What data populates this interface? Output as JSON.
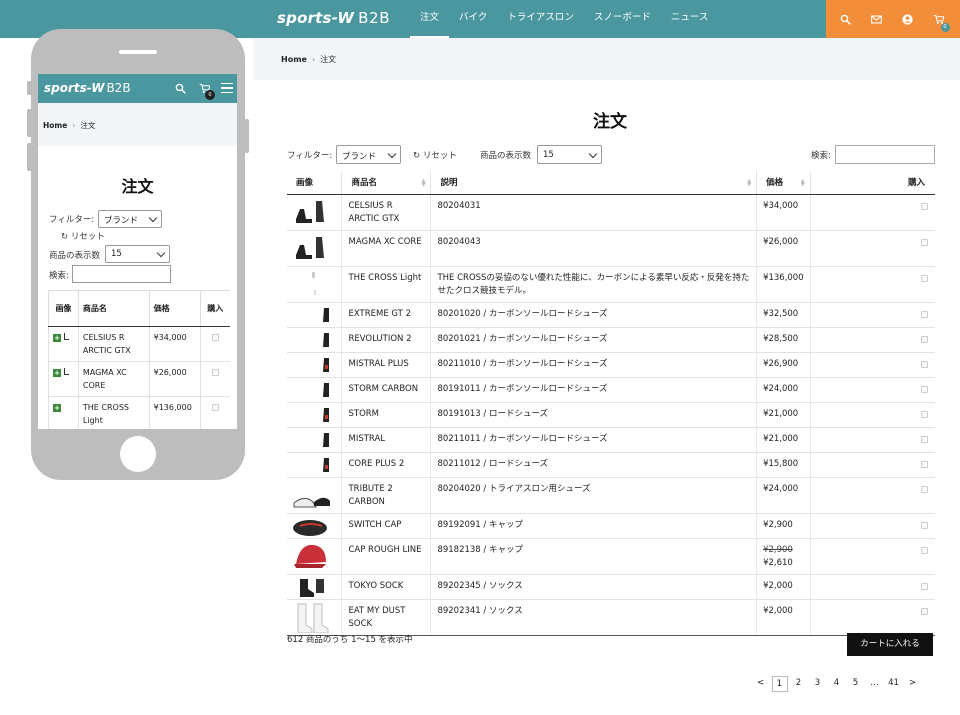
{
  "brand": {
    "logo_text": "sports-W",
    "logo_suffix": "B2B"
  },
  "nav": [
    {
      "label": "注文",
      "active": true
    },
    {
      "label": "バイク",
      "active": false
    },
    {
      "label": "トライアスロン",
      "active": false
    },
    {
      "label": "スノーボード",
      "active": false
    },
    {
      "label": "ニュース",
      "active": false
    }
  ],
  "header_icons": [
    "search-icon",
    "mail-icon",
    "account-icon",
    "cart-icon"
  ],
  "cart_count": "0",
  "breadcrumb": {
    "home": "Home",
    "sep": "›",
    "current": "注文"
  },
  "page_title": "注文",
  "filters": {
    "filter_label": "フィルター:",
    "brand_select": "ブランド",
    "reset_label": "リセット",
    "per_page_label": "商品の表示数",
    "per_page_value": "15",
    "search_label": "検索:",
    "search_value": ""
  },
  "table": {
    "headers": {
      "image": "画像",
      "name": "商品名",
      "desc": "説明",
      "price": "価格",
      "buy": "購入"
    },
    "rows": [
      {
        "name": "CELSIUS R ARCTIC GTX",
        "desc": "80204031",
        "price": "¥34,000",
        "thumb": "boots"
      },
      {
        "name": "MAGMA XC CORE",
        "desc": "80204043",
        "price": "¥26,000",
        "thumb": "boots"
      },
      {
        "name": "THE CROSS Light",
        "desc": "THE CROSSの妥協のない優れた性能に、カーボンによる素早い反応・反発を持たせたクロス競技モデル。",
        "price": "¥136,000",
        "thumb": "light"
      },
      {
        "name": "EXTREME GT 2",
        "desc": "80201020 / カーボンソールロードシューズ",
        "price": "¥32,500",
        "thumb": "shoe"
      },
      {
        "name": "REVOLUTION 2",
        "desc": "80201021 / カーボンソールロードシューズ",
        "price": "¥28,500",
        "thumb": "shoe"
      },
      {
        "name": "MISTRAL PLUS",
        "desc": "80211010 / カーボンソールロードシューズ",
        "price": "¥26,900",
        "thumb": "shoe-red"
      },
      {
        "name": "STORM CARBON",
        "desc": "80191011 / カーボンソールロードシューズ",
        "price": "¥24,000",
        "thumb": "shoe"
      },
      {
        "name": "STORM",
        "desc": "80191013 / ロードシューズ",
        "price": "¥21,000",
        "thumb": "shoe-red"
      },
      {
        "name": "MISTRAL",
        "desc": "80211011 / カーボンソールロードシューズ",
        "price": "¥21,000",
        "thumb": "shoe"
      },
      {
        "name": "CORE PLUS 2",
        "desc": "80211012 / ロードシューズ",
        "price": "¥15,800",
        "thumb": "shoe-red"
      },
      {
        "name": "TRIBUTE 2 CARBON",
        "desc": "80204020 / トライアスロン用シューズ",
        "price": "¥24,000",
        "thumb": "shoe-white"
      },
      {
        "name": "SWITCH CAP",
        "desc": "89192091 / キャップ",
        "price": "¥2,900",
        "thumb": "cap-dark"
      },
      {
        "name": "CAP ROUGH LINE",
        "desc": "89182138 / キャップ",
        "price": "¥2,610",
        "old_price": "¥2,900",
        "thumb": "cap-red"
      },
      {
        "name": "TOKYO SOCK",
        "desc": "89202345 / ソックス",
        "price": "¥2,000",
        "thumb": "sock-dark"
      },
      {
        "name": "EAT MY DUST SOCK",
        "desc": "89202341 / ソックス",
        "price": "¥2,000",
        "thumb": "sock-white"
      }
    ]
  },
  "result_count": "612 商品のうち 1〜15 を表示中",
  "add_to_cart": "カートに入れる",
  "pagination": {
    "prev": "<",
    "pages": [
      "1",
      "2",
      "3",
      "4",
      "5"
    ],
    "ellipsis": "…",
    "last": "41",
    "next": ">",
    "current": "1"
  },
  "mobile": {
    "cart_count": "0",
    "headers": {
      "image": "画像",
      "name": "商品名",
      "price": "価格",
      "buy": "購入"
    },
    "rows": [
      {
        "name": "CELSIUS R ARCTIC GTX",
        "price": "¥34,000"
      },
      {
        "name": "MAGMA XC CORE",
        "price": "¥26,000"
      },
      {
        "name": "THE CROSS Light",
        "price": "¥136,000"
      }
    ]
  },
  "colors": {
    "teal": "#4a97a0",
    "orange": "#f28d3a",
    "crumb_bg": "#f3f6f9",
    "button": "#111111"
  }
}
